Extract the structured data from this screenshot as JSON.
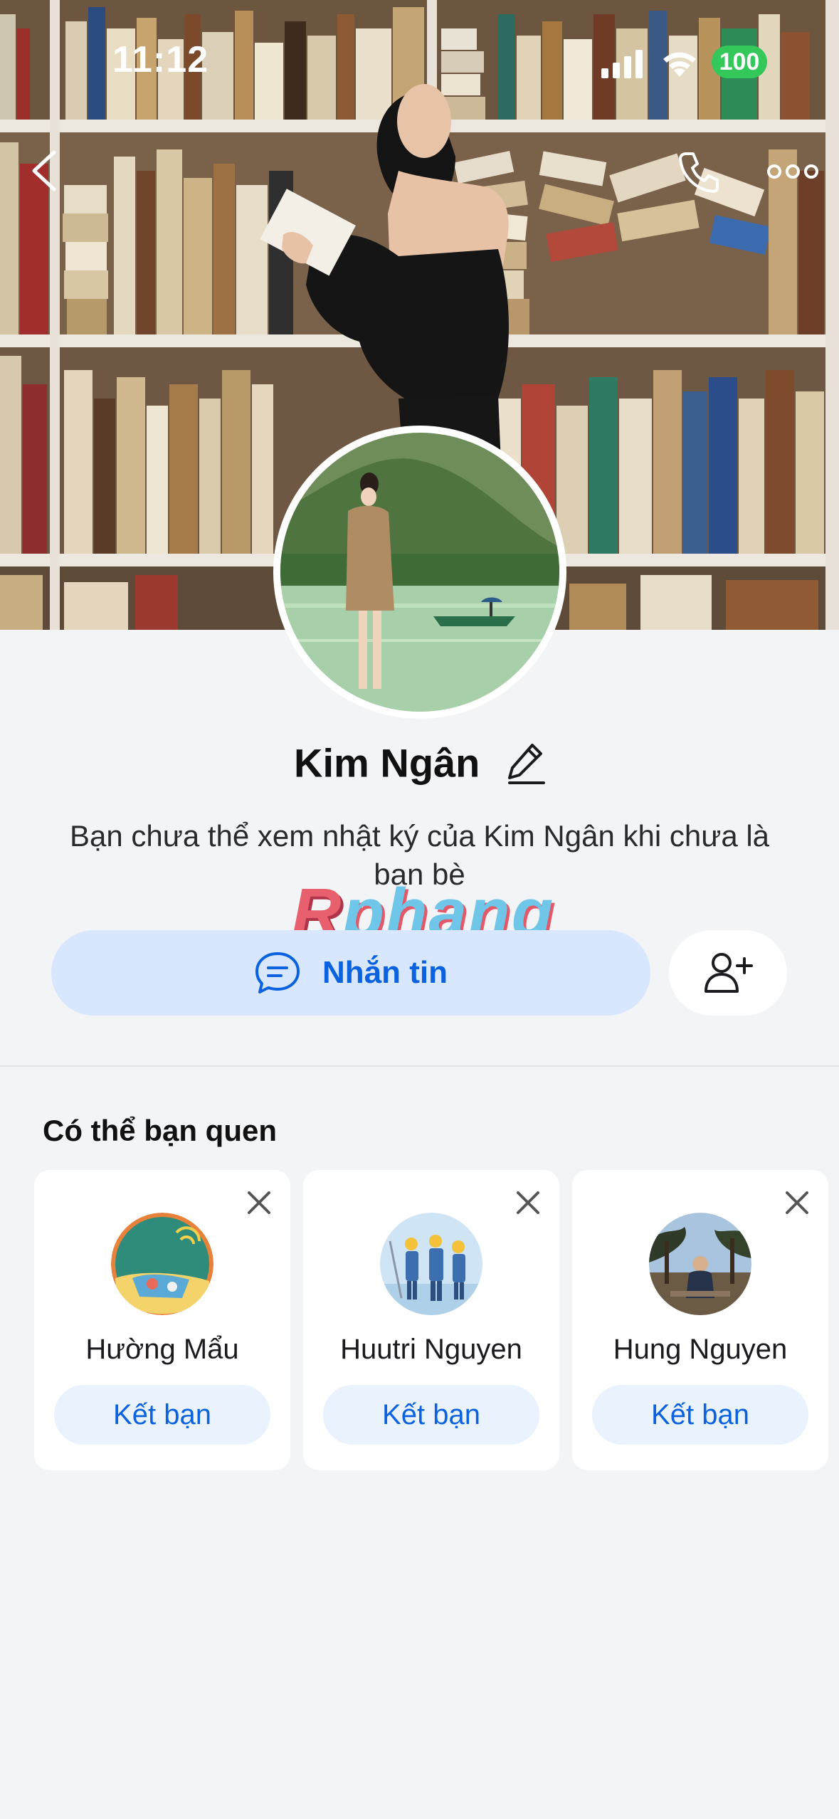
{
  "status_bar": {
    "time": "11:12",
    "battery": "100"
  },
  "profile": {
    "name": "Kim Ngân",
    "privacy_note": "Bạn chưa thể xem nhật ký của Kim Ngân khi chưa là bạn bè"
  },
  "watermark": {
    "first": "R",
    "rest": "phang"
  },
  "actions": {
    "message_label": "Nhắn tin"
  },
  "suggestions": {
    "title": "Có thể bạn quen",
    "cards": [
      {
        "name": "Hường Mẩu",
        "button": "Kết bạn"
      },
      {
        "name": "Huutri Nguyen",
        "button": "Kết bạn"
      },
      {
        "name": "Hung Nguyen",
        "button": "Kết bạn"
      }
    ]
  },
  "colors": {
    "accent": "#0a62e0",
    "message_button_bg": "#d8e7fd",
    "add_friend_bg": "#eaf2fe",
    "page_bg": "#f3f4f6",
    "battery": "#34c759"
  },
  "icons": {
    "back": "chevron-left-icon",
    "call": "phone-icon",
    "more": "more-dots-icon",
    "edit": "pencil-icon",
    "message": "chat-bubble-icon",
    "add_friend": "person-add-icon",
    "close": "close-icon"
  }
}
